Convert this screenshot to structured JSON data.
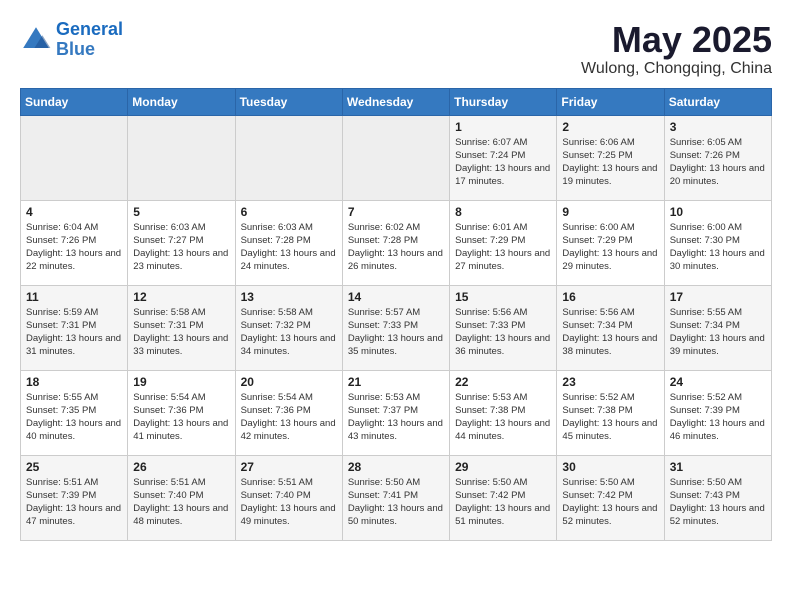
{
  "header": {
    "logo_line1": "General",
    "logo_line2": "Blue",
    "month": "May 2025",
    "location": "Wulong, Chongqing, China"
  },
  "weekdays": [
    "Sunday",
    "Monday",
    "Tuesday",
    "Wednesday",
    "Thursday",
    "Friday",
    "Saturday"
  ],
  "weeks": [
    [
      {
        "day": "",
        "empty": true
      },
      {
        "day": "",
        "empty": true
      },
      {
        "day": "",
        "empty": true
      },
      {
        "day": "",
        "empty": true
      },
      {
        "day": "1",
        "sunrise": "6:07 AM",
        "sunset": "7:24 PM",
        "daylight": "13 hours and 17 minutes."
      },
      {
        "day": "2",
        "sunrise": "6:06 AM",
        "sunset": "7:25 PM",
        "daylight": "13 hours and 19 minutes."
      },
      {
        "day": "3",
        "sunrise": "6:05 AM",
        "sunset": "7:26 PM",
        "daylight": "13 hours and 20 minutes."
      }
    ],
    [
      {
        "day": "4",
        "sunrise": "6:04 AM",
        "sunset": "7:26 PM",
        "daylight": "13 hours and 22 minutes."
      },
      {
        "day": "5",
        "sunrise": "6:03 AM",
        "sunset": "7:27 PM",
        "daylight": "13 hours and 23 minutes."
      },
      {
        "day": "6",
        "sunrise": "6:03 AM",
        "sunset": "7:28 PM",
        "daylight": "13 hours and 24 minutes."
      },
      {
        "day": "7",
        "sunrise": "6:02 AM",
        "sunset": "7:28 PM",
        "daylight": "13 hours and 26 minutes."
      },
      {
        "day": "8",
        "sunrise": "6:01 AM",
        "sunset": "7:29 PM",
        "daylight": "13 hours and 27 minutes."
      },
      {
        "day": "9",
        "sunrise": "6:00 AM",
        "sunset": "7:29 PM",
        "daylight": "13 hours and 29 minutes."
      },
      {
        "day": "10",
        "sunrise": "6:00 AM",
        "sunset": "7:30 PM",
        "daylight": "13 hours and 30 minutes."
      }
    ],
    [
      {
        "day": "11",
        "sunrise": "5:59 AM",
        "sunset": "7:31 PM",
        "daylight": "13 hours and 31 minutes."
      },
      {
        "day": "12",
        "sunrise": "5:58 AM",
        "sunset": "7:31 PM",
        "daylight": "13 hours and 33 minutes."
      },
      {
        "day": "13",
        "sunrise": "5:58 AM",
        "sunset": "7:32 PM",
        "daylight": "13 hours and 34 minutes."
      },
      {
        "day": "14",
        "sunrise": "5:57 AM",
        "sunset": "7:33 PM",
        "daylight": "13 hours and 35 minutes."
      },
      {
        "day": "15",
        "sunrise": "5:56 AM",
        "sunset": "7:33 PM",
        "daylight": "13 hours and 36 minutes."
      },
      {
        "day": "16",
        "sunrise": "5:56 AM",
        "sunset": "7:34 PM",
        "daylight": "13 hours and 38 minutes."
      },
      {
        "day": "17",
        "sunrise": "5:55 AM",
        "sunset": "7:34 PM",
        "daylight": "13 hours and 39 minutes."
      }
    ],
    [
      {
        "day": "18",
        "sunrise": "5:55 AM",
        "sunset": "7:35 PM",
        "daylight": "13 hours and 40 minutes."
      },
      {
        "day": "19",
        "sunrise": "5:54 AM",
        "sunset": "7:36 PM",
        "daylight": "13 hours and 41 minutes."
      },
      {
        "day": "20",
        "sunrise": "5:54 AM",
        "sunset": "7:36 PM",
        "daylight": "13 hours and 42 minutes."
      },
      {
        "day": "21",
        "sunrise": "5:53 AM",
        "sunset": "7:37 PM",
        "daylight": "13 hours and 43 minutes."
      },
      {
        "day": "22",
        "sunrise": "5:53 AM",
        "sunset": "7:38 PM",
        "daylight": "13 hours and 44 minutes."
      },
      {
        "day": "23",
        "sunrise": "5:52 AM",
        "sunset": "7:38 PM",
        "daylight": "13 hours and 45 minutes."
      },
      {
        "day": "24",
        "sunrise": "5:52 AM",
        "sunset": "7:39 PM",
        "daylight": "13 hours and 46 minutes."
      }
    ],
    [
      {
        "day": "25",
        "sunrise": "5:51 AM",
        "sunset": "7:39 PM",
        "daylight": "13 hours and 47 minutes."
      },
      {
        "day": "26",
        "sunrise": "5:51 AM",
        "sunset": "7:40 PM",
        "daylight": "13 hours and 48 minutes."
      },
      {
        "day": "27",
        "sunrise": "5:51 AM",
        "sunset": "7:40 PM",
        "daylight": "13 hours and 49 minutes."
      },
      {
        "day": "28",
        "sunrise": "5:50 AM",
        "sunset": "7:41 PM",
        "daylight": "13 hours and 50 minutes."
      },
      {
        "day": "29",
        "sunrise": "5:50 AM",
        "sunset": "7:42 PM",
        "daylight": "13 hours and 51 minutes."
      },
      {
        "day": "30",
        "sunrise": "5:50 AM",
        "sunset": "7:42 PM",
        "daylight": "13 hours and 52 minutes."
      },
      {
        "day": "31",
        "sunrise": "5:50 AM",
        "sunset": "7:43 PM",
        "daylight": "13 hours and 52 minutes."
      }
    ]
  ]
}
